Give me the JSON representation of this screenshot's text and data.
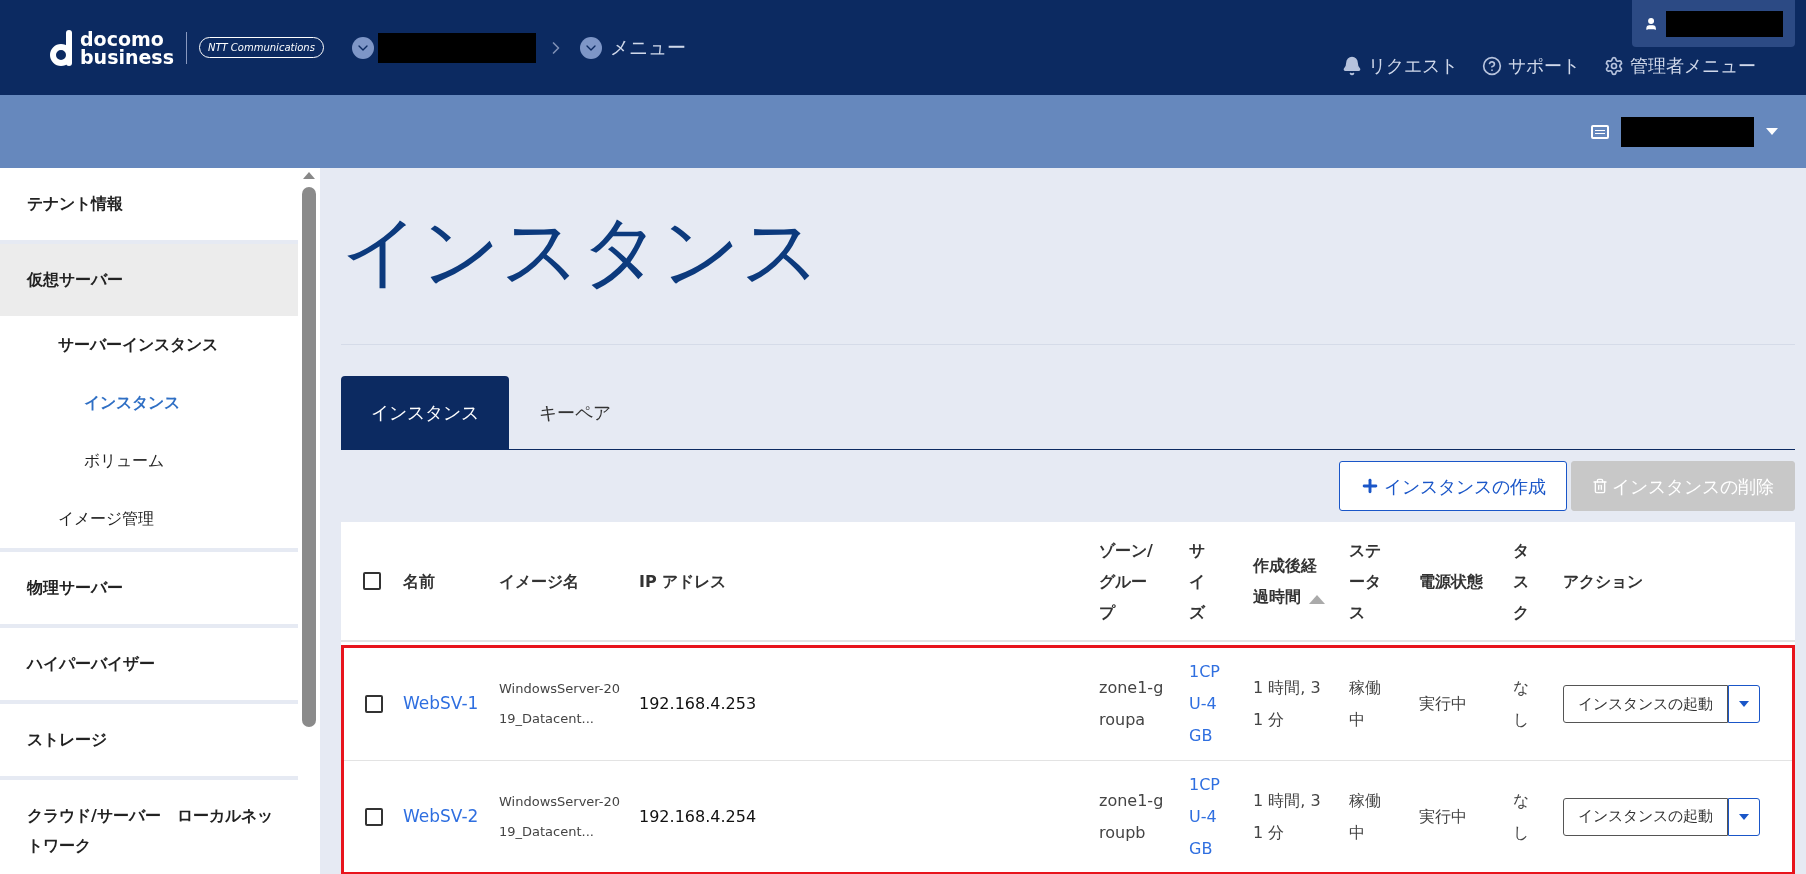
{
  "header": {
    "logo": {
      "line_1": "docomo",
      "line_2": "business",
      "partner": "NTT Communications"
    },
    "menu": "メニュー",
    "links": [
      {
        "kind": "bell",
        "label": "リクエスト"
      },
      {
        "kind": "help",
        "label": "サポート"
      },
      {
        "kind": "gear",
        "label": "管理者メニュー"
      }
    ]
  },
  "sidebar": {
    "items": [
      {
        "label": "テナント情報",
        "selected": false
      },
      {
        "label": "仮想サーバー",
        "selected": true,
        "children": [
          {
            "label": "サーバーインスタンス",
            "selected": false,
            "children": [
              {
                "label": "インスタンス",
                "selected": true
              },
              {
                "label": "ボリューム",
                "selected": false
              }
            ]
          },
          {
            "label": "イメージ管理",
            "selected": false
          }
        ]
      },
      {
        "label": "物理サーバー",
        "selected": false
      },
      {
        "label": "ハイパーバイザー",
        "selected": false
      },
      {
        "label": "ストレージ",
        "selected": false
      },
      {
        "label": "クラウド/サーバー　ローカルネットワーク",
        "selected": false
      }
    ]
  },
  "page_title": "インスタンス",
  "tabs": [
    {
      "label": "インスタンス",
      "selected": true
    },
    {
      "label": "キーペア",
      "selected": false
    }
  ],
  "actions": [
    {
      "label": "インスタンスの作成",
      "kind": "create",
      "disabled": false
    },
    {
      "label": "インスタンスの削除",
      "kind": "delete",
      "disabled": true
    }
  ],
  "table": {
    "select_all": {
      "checked": false
    },
    "columns": [
      {
        "label": "名前",
        "sorted": false
      },
      {
        "label": "イメージ名",
        "sorted": false
      },
      {
        "label": "IP アドレス",
        "sorted": false
      },
      {
        "label": "ゾーン/グループ",
        "sorted": false
      },
      {
        "label": "サイズ",
        "sorted": false
      },
      {
        "label": "作成後経過時間",
        "sorted": true
      },
      {
        "label": "ステータス",
        "sorted": false
      },
      {
        "label": "電源状態",
        "sorted": false
      },
      {
        "label": "タスク",
        "sorted": false
      },
      {
        "label": "アクション",
        "sorted": false
      }
    ],
    "rows": [
      {
        "checked": false,
        "name": "WebSV-1",
        "image": "WindowsServer-2019_Datacent...",
        "ip": "192.168.4.253",
        "zone": "zone1-groupa",
        "size": "1CPU-4GB",
        "elapsed": "1 時間, 31 分",
        "status": "稼働中",
        "power": "実行中",
        "task": "なし",
        "action": "インスタンスの起動"
      },
      {
        "checked": false,
        "name": "WebSV-2",
        "image": "WindowsServer-2019_Datacent...",
        "ip": "192.168.4.254",
        "zone": "zone1-groupb",
        "size": "1CPU-4GB",
        "elapsed": "1 時間, 31 分",
        "status": "稼働中",
        "power": "実行中",
        "task": "なし",
        "action": "インスタンスの起動"
      }
    ]
  }
}
